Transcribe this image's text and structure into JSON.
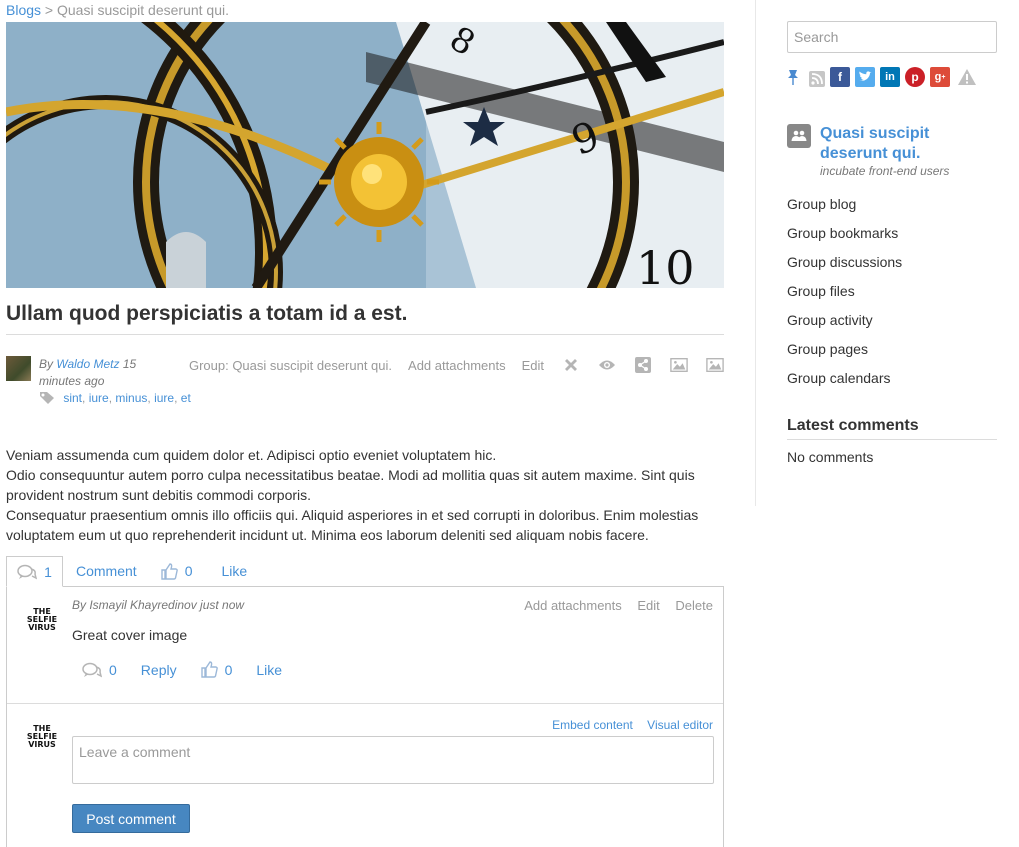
{
  "breadcrumb": {
    "root": "Blogs",
    "sep": ">",
    "current": "Quasi suscipit deserunt qui."
  },
  "post": {
    "title": "Ullam quod perspiciatis a totam id a est.",
    "by": "By",
    "author": "Waldo Metz",
    "time": "15 minutes ago",
    "tags": [
      "sint",
      "iure",
      "minus",
      "iure",
      "et"
    ],
    "group_link": "Group: Quasi suscipit deserunt qui.",
    "add_attachments": "Add attachments",
    "edit": "Edit",
    "paragraphs": [
      "Veniam assumenda cum quidem dolor et. Adipisci optio eveniet voluptatem hic.",
      "Odio consequuntur autem porro culpa necessitatibus beatae. Modi ad mollitia quas sit autem maxime. Sint quis provident nostrum sunt debitis commodi corporis.",
      "Consequatur praesentium omnis illo officiis qui. Aliquid asperiores in et sed corrupti in doloribus. Enim molestias voluptatem eum ut quo reprehenderit incidunt ut. Minima eos laborum deleniti sed aliquam nobis facere."
    ]
  },
  "tabs": {
    "comment_count": "1",
    "comment": "Comment",
    "like_count": "0",
    "like": "Like"
  },
  "comment": {
    "avatar_text": "THE SELFIE VIRUS",
    "byline": "By Ismayil Khayredinov just now",
    "add_attachments": "Add attachments",
    "edit": "Edit",
    "delete": "Delete",
    "text": "Great cover image",
    "reply_count": "0",
    "reply": "Reply",
    "like_count": "0",
    "like": "Like"
  },
  "new_comment": {
    "avatar_text": "THE SELFIE VIRUS",
    "embed": "Embed content",
    "visual_editor": "Visual editor",
    "placeholder": "Leave a comment",
    "submit": "Post comment"
  },
  "sidebar": {
    "search_placeholder": "Search",
    "social_icons": [
      "pin-icon",
      "rss-icon",
      "facebook-icon",
      "twitter-icon",
      "linkedin-icon",
      "pinterest-icon",
      "google-plus-icon",
      "report-icon"
    ],
    "group_name": "Quasi suscipit deserunt qui.",
    "group_desc": "incubate front-end users",
    "menu": [
      "Group blog",
      "Group bookmarks",
      "Group discussions",
      "Group files",
      "Group activity",
      "Group pages",
      "Group calendars"
    ],
    "latest_title": "Latest comments",
    "no_comments": "No comments"
  },
  "colors": {
    "link": "#4690d6",
    "button": "#4787c1",
    "facebook": "#3b5998",
    "twitter": "#55acee",
    "linkedin": "#0077b5",
    "pinterest": "#cb2027",
    "google": "#dd4b39"
  }
}
